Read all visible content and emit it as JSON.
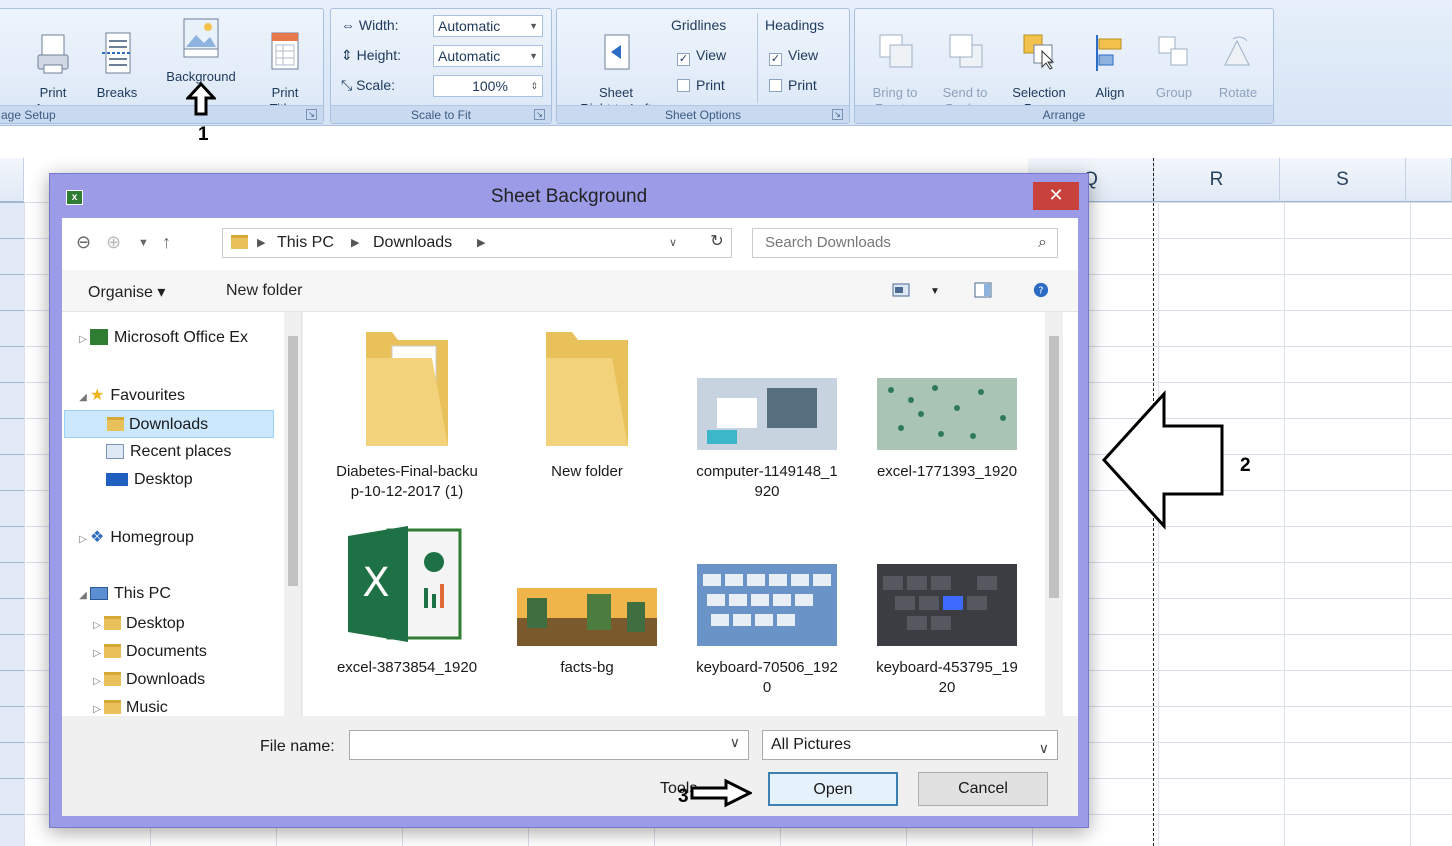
{
  "ribbon": {
    "page_setup": {
      "label": "age Setup",
      "print_area": "Print\nArea ▾",
      "breaks": "Breaks\n▾",
      "background": "Background",
      "print_titles": "Print\nTitles"
    },
    "scale_to_fit": {
      "label": "Scale to Fit",
      "width_label": "Width:",
      "width_value": "Automatic",
      "height_label": "Height:",
      "height_value": "Automatic",
      "scale_label": "Scale:",
      "scale_value": "100%"
    },
    "sheet_options": {
      "label": "Sheet Options",
      "right_to_left": "Sheet\nRight-to-Left",
      "gridlines": "Gridlines",
      "headings": "Headings",
      "view": "View",
      "print": "Print"
    },
    "arrange": {
      "label": "Arrange",
      "bring_to_front": "Bring to\nFront ▾",
      "send_to_back": "Send to\nBack ▾",
      "selection_pane": "Selection\nPane",
      "align": "Align\n▾",
      "group": "Group\n▾",
      "rotate": "Rotate\n▾"
    }
  },
  "sheet": {
    "columns": [
      "Q",
      "R",
      "S"
    ]
  },
  "dialog": {
    "title": "Sheet Background",
    "close": "✕",
    "breadcrumb": [
      "This PC",
      "Downloads"
    ],
    "search_placeholder": "Search Downloads",
    "organise": "Organise ▾",
    "new_folder": "New folder",
    "nav": {
      "office": "Microsoft Office Ex",
      "favourites": "Favourites",
      "downloads": "Downloads",
      "recent": "Recent places",
      "desktop": "Desktop",
      "homegroup": "Homegroup",
      "this_pc": "This PC",
      "pc_desktop": "Desktop",
      "pc_documents": "Documents",
      "pc_downloads": "Downloads",
      "pc_music": "Music"
    },
    "files": [
      "Diabetes-Final-backup-10-12-2017 (1)",
      "New folder",
      "computer-1149148_1920",
      "excel-1771393_1920",
      "excel-3873854_1920",
      "facts-bg",
      "keyboard-70506_1920",
      "keyboard-453795_1920"
    ],
    "file_name_label": "File name:",
    "file_type": "All Pictures",
    "tools": "Tools",
    "open": "Open",
    "cancel": "Cancel"
  },
  "annotations": {
    "one": "1",
    "two": "2",
    "three": "3"
  }
}
